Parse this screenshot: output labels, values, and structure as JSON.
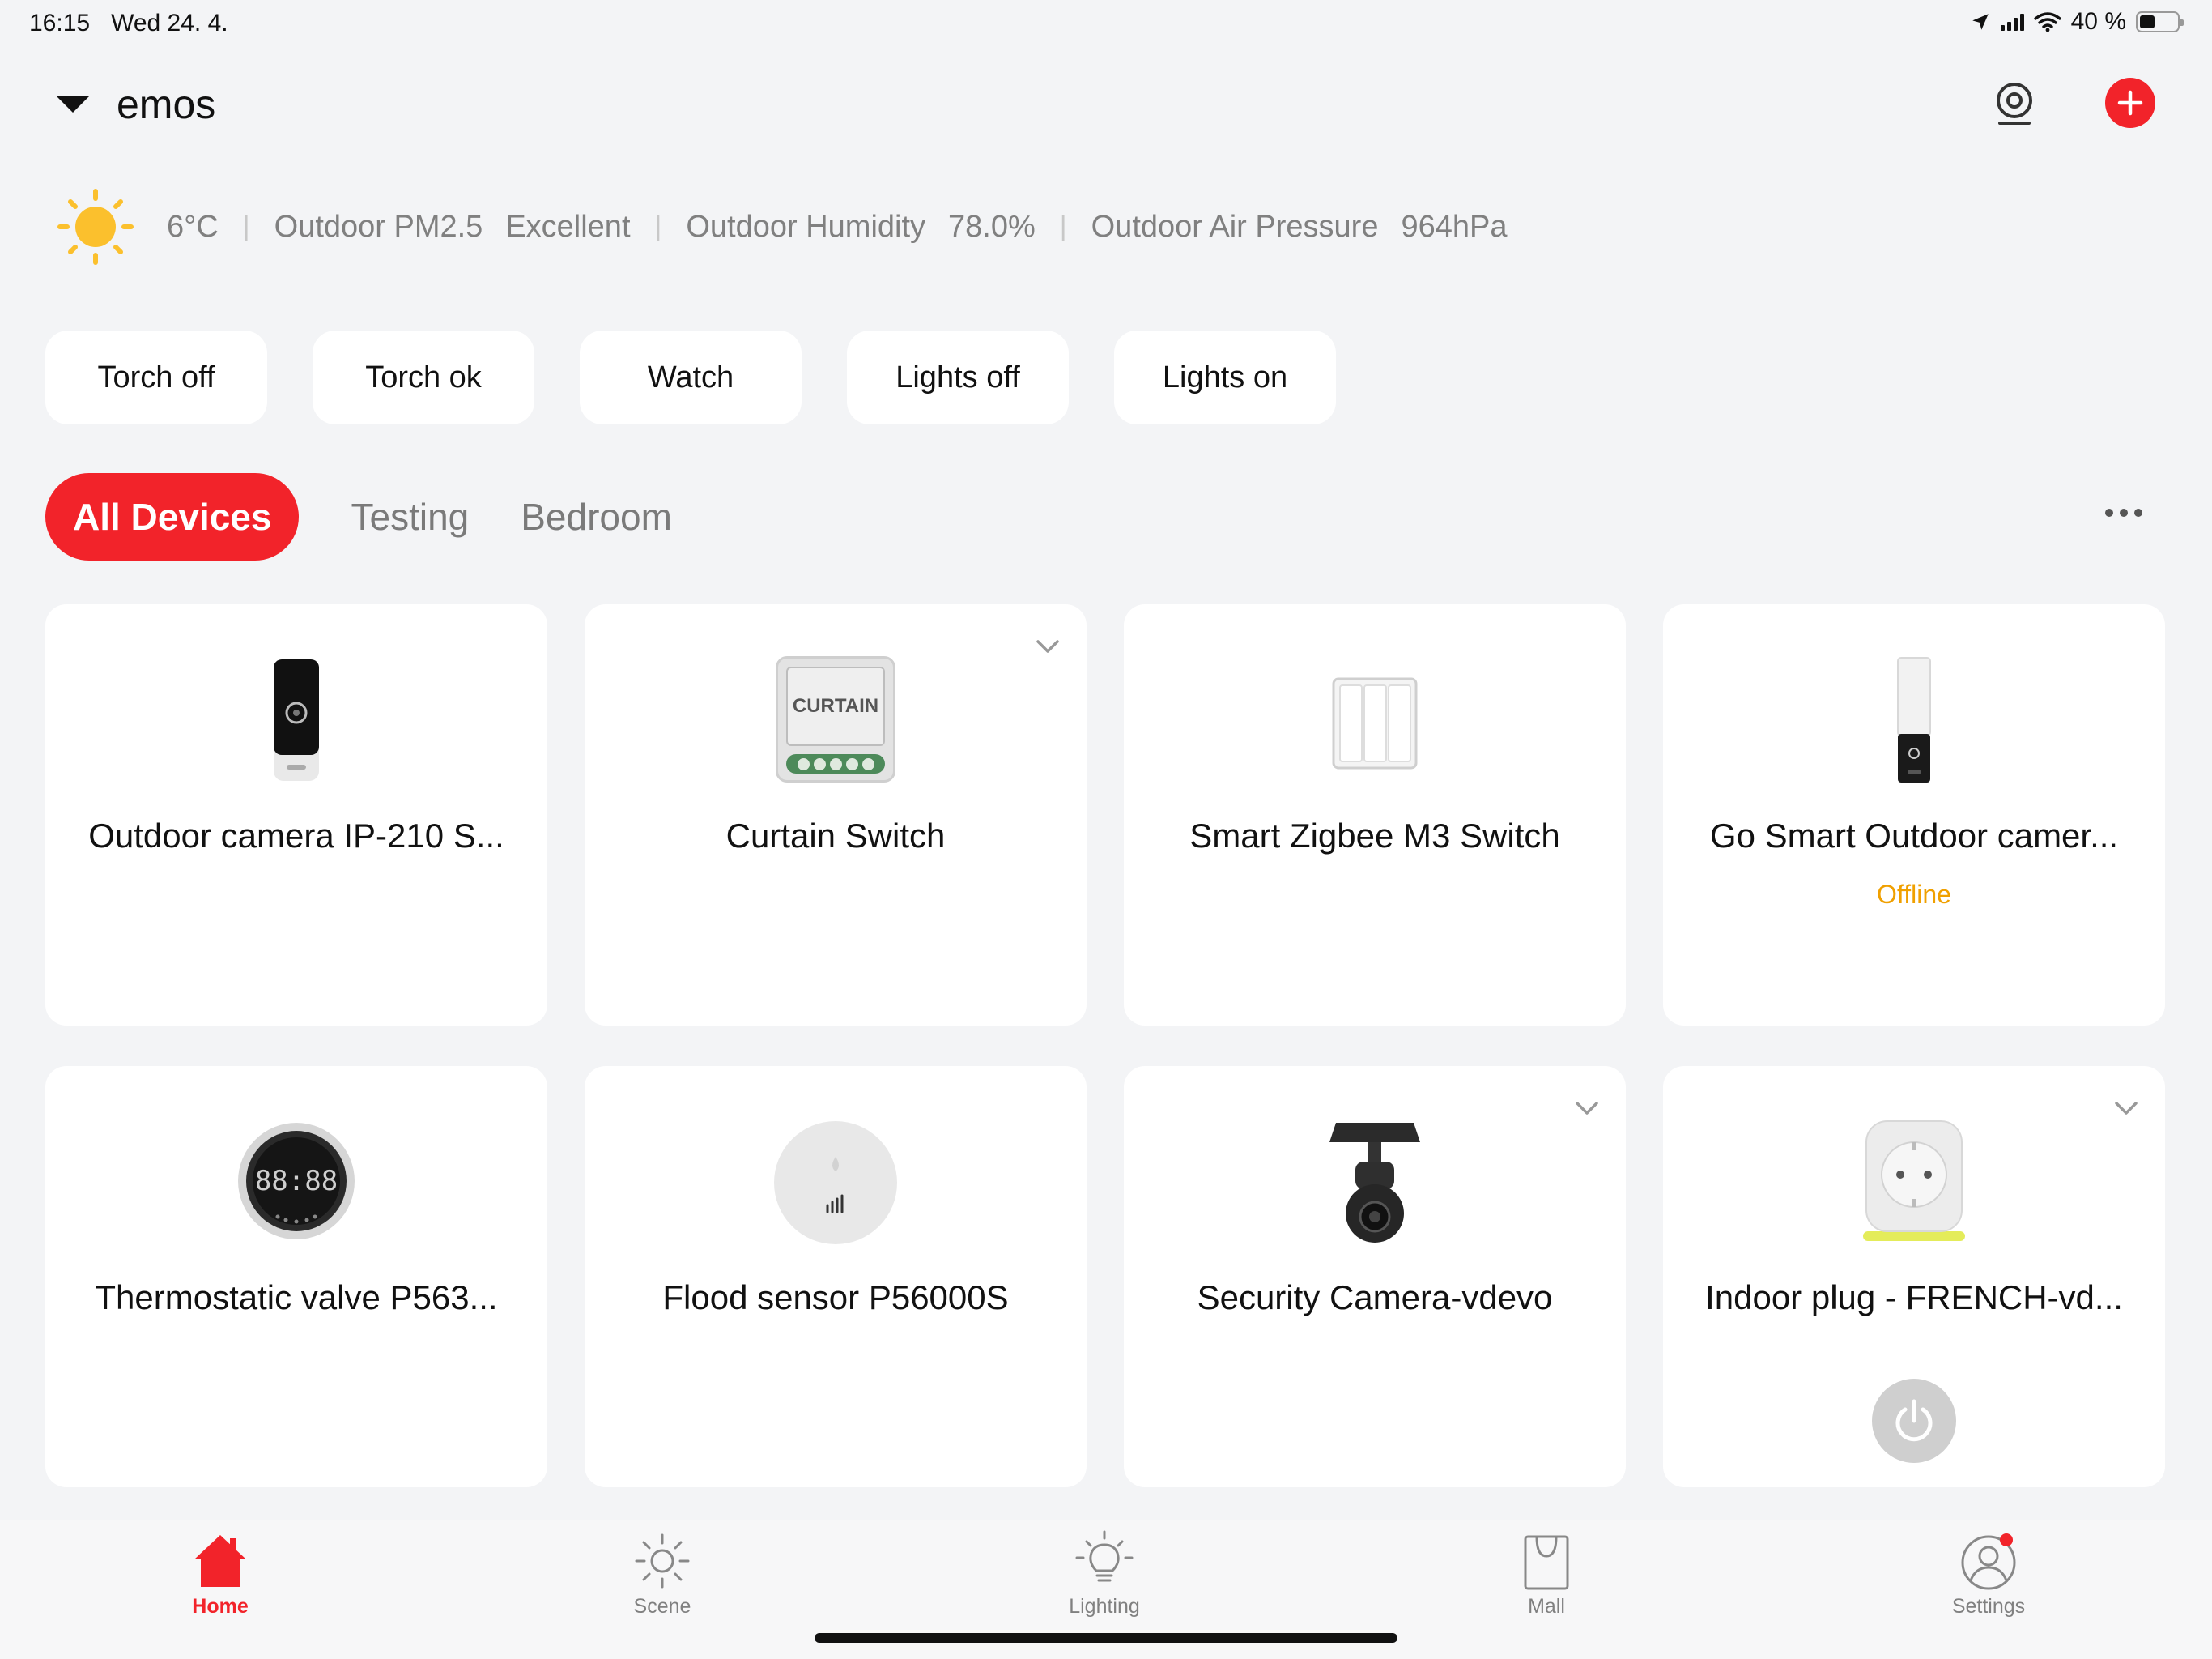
{
  "status_bar": {
    "time": "16:15",
    "date": "Wed 24. 4.",
    "battery": "40 %"
  },
  "header": {
    "home_name": "emos"
  },
  "weather": {
    "temperature": "6°C",
    "pm25_label": "Outdoor PM2.5",
    "pm25_value": "Excellent",
    "humidity_label": "Outdoor Humidity",
    "humidity_value": "78.0%",
    "pressure_label": "Outdoor Air Pressure",
    "pressure_value": "964hPa"
  },
  "scenes": [
    "Torch off",
    "Torch ok",
    "Watch",
    "Lights off",
    "Lights on"
  ],
  "rooms": {
    "active": "All Devices",
    "others": [
      "Testing",
      "Bedroom"
    ]
  },
  "devices": [
    {
      "name": "Outdoor camera IP-210 S...",
      "state": ""
    },
    {
      "name": "Curtain Switch",
      "state": "",
      "thumb_text": "CURTAIN"
    },
    {
      "name": "Smart Zigbee M3 Switch",
      "state": ""
    },
    {
      "name": "Go Smart Outdoor camer...",
      "state": "Offline"
    },
    {
      "name": "Thermostatic valve P563...",
      "state": "",
      "thumb_text": "88:88"
    },
    {
      "name": "Flood sensor P56000S",
      "state": ""
    },
    {
      "name": "Security Camera-vdevo",
      "state": ""
    },
    {
      "name": "Indoor plug - FRENCH-vd...",
      "state": ""
    }
  ],
  "tabbar": {
    "home": "Home",
    "scene": "Scene",
    "lighting": "Lighting",
    "mall": "Mall",
    "settings": "Settings"
  },
  "colors": {
    "accent": "#f2232a",
    "offline": "#f0a000",
    "background": "#f3f4f6"
  }
}
